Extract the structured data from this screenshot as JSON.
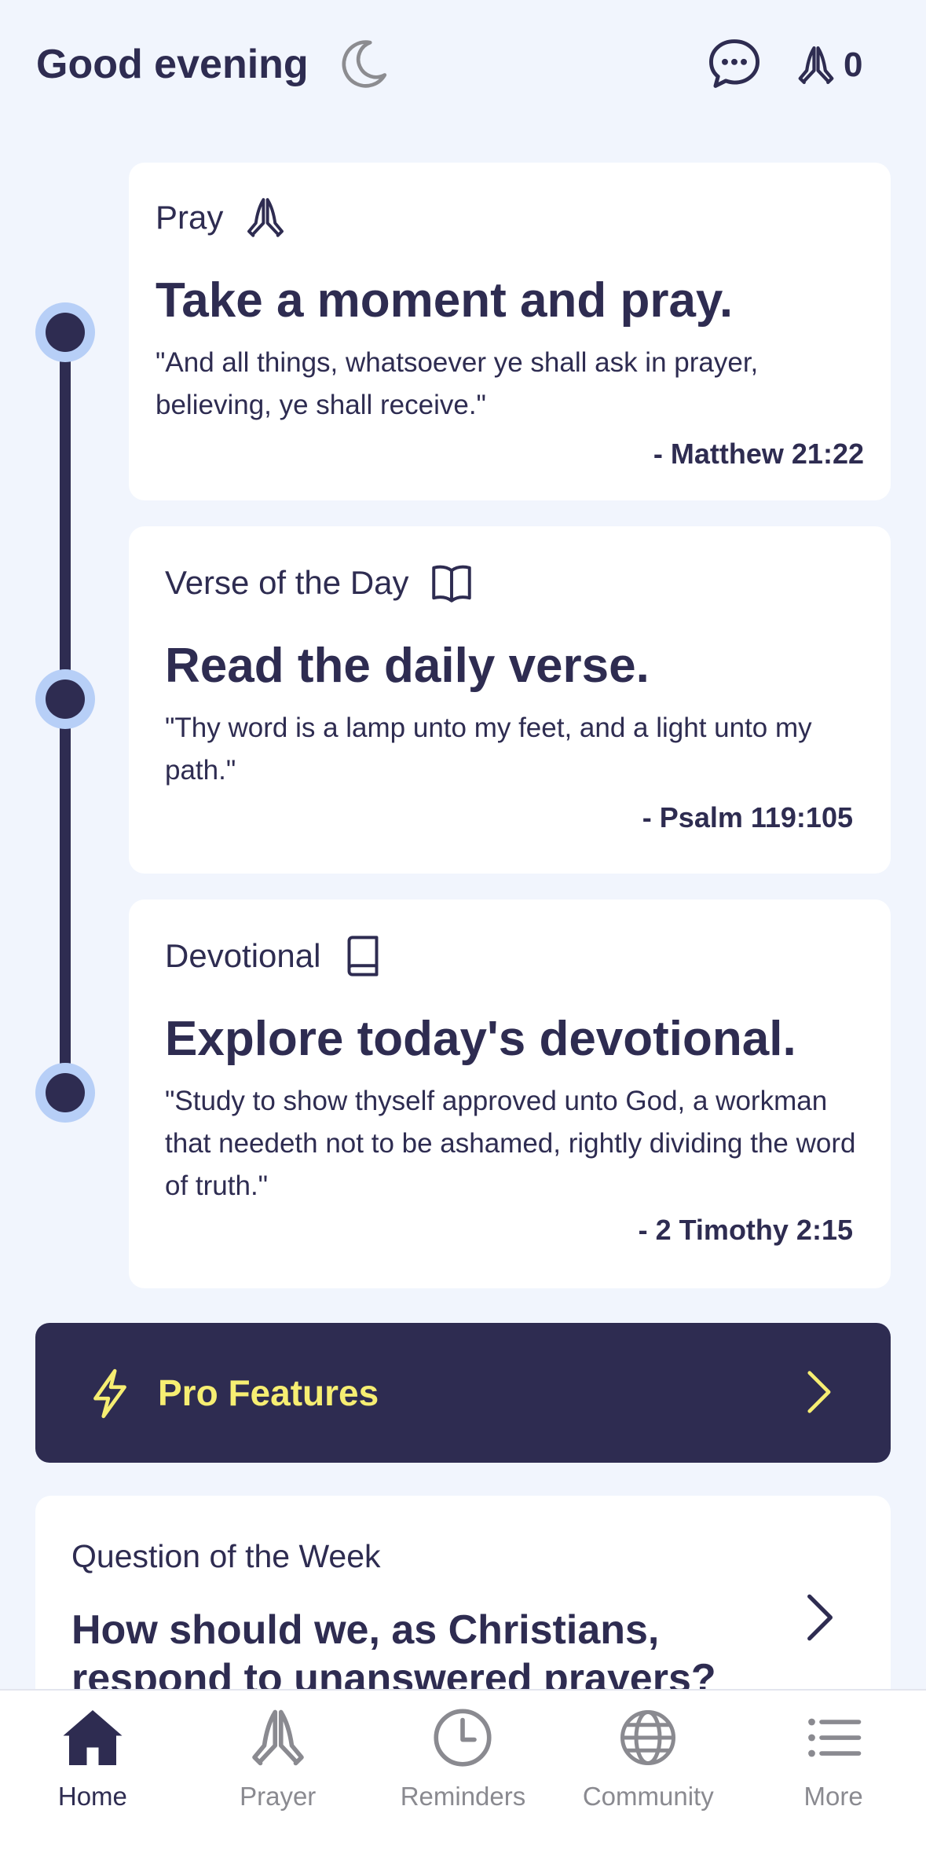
{
  "header": {
    "greeting": "Good evening",
    "greeting_icon": "moon-icon",
    "chat_icon": "chat-bubble-icon",
    "prayer_icon": "praying-hands-icon",
    "prayer_count": "0"
  },
  "cards": [
    {
      "label": "Pray",
      "icon": "praying-hands-icon",
      "title": "Take a moment and pray.",
      "quote": "\"And all things, whatsoever ye shall ask in prayer, believing, ye shall receive.\"",
      "reference": "- Matthew 21:22"
    },
    {
      "label": "Verse of the Day",
      "icon": "open-book-icon",
      "title": "Read the daily verse.",
      "quote": "\"Thy word is a lamp unto my feet, and a light unto my path.\"",
      "reference": "- Psalm 119:105"
    },
    {
      "label": "Devotional",
      "icon": "book-icon",
      "title": "Explore today's devotional.",
      "quote": "\"Study to show thyself approved unto God, a workman that needeth not to be ashamed, rightly dividing the word of truth.\"",
      "reference": "- 2 Timothy 2:15"
    }
  ],
  "pro": {
    "label": "Pro Features",
    "icon": "lightning-bolt-icon",
    "accent": "#f6ee72"
  },
  "question_of_week": {
    "label": "Question of the Week",
    "question": "How should we, as Christians, respond to unanswered prayers?"
  },
  "nav": {
    "items": [
      {
        "label": "Home",
        "icon": "home-icon",
        "active": true
      },
      {
        "label": "Prayer",
        "icon": "praying-hands-icon",
        "active": false
      },
      {
        "label": "Reminders",
        "icon": "clock-icon",
        "active": false
      },
      {
        "label": "Community",
        "icon": "globe-icon",
        "active": false
      },
      {
        "label": "More",
        "icon": "list-icon",
        "active": false
      }
    ]
  },
  "colors": {
    "background": "#f1f5fd",
    "primary": "#2e2c51",
    "timeline_ring": "#b7cff7",
    "inactive": "#8a8a90"
  }
}
